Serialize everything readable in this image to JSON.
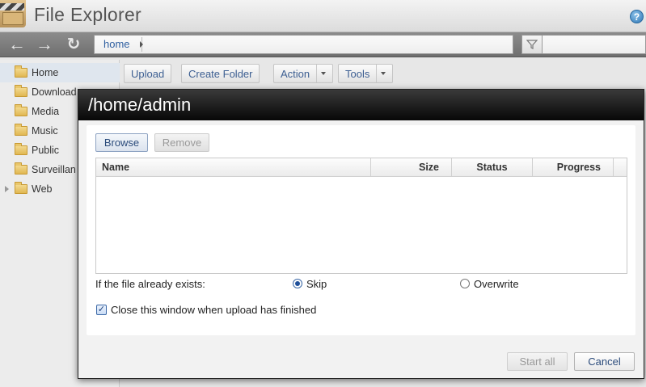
{
  "app": {
    "title": "File Explorer"
  },
  "nav": {
    "crumbs": [
      "home"
    ]
  },
  "sidebar": {
    "items": [
      {
        "label": "Home",
        "selected": true,
        "expandable": false
      },
      {
        "label": "Download",
        "selected": false,
        "expandable": false
      },
      {
        "label": "Media",
        "selected": false,
        "expandable": false
      },
      {
        "label": "Music",
        "selected": false,
        "expandable": false
      },
      {
        "label": "Public",
        "selected": false,
        "expandable": false
      },
      {
        "label": "Surveillan",
        "selected": false,
        "expandable": false
      },
      {
        "label": "Web",
        "selected": false,
        "expandable": true
      }
    ]
  },
  "toolbar": {
    "upload": "Upload",
    "create_folder": "Create Folder",
    "action": "Action",
    "tools": "Tools"
  },
  "dialog": {
    "title": "/home/admin",
    "browse": "Browse",
    "remove": "Remove",
    "columns": {
      "name": "Name",
      "size": "Size",
      "status": "Status",
      "progress": "Progress"
    },
    "exists_label": "If the file already exists:",
    "option_skip": "Skip",
    "option_overwrite": "Overwrite",
    "selected_option": "Skip",
    "close_when_done": "Close this window when upload has finished",
    "close_when_done_checked": true,
    "start_all": "Start all",
    "cancel": "Cancel"
  },
  "icons": {
    "back": "arrow-left-icon",
    "forward": "arrow-right-icon",
    "refresh": "refresh-icon",
    "filter": "funnel-icon",
    "help": "question-icon",
    "folder": "folder-icon"
  },
  "colors": {
    "accent": "#2f5fa0",
    "dialog_header": "#0a0a0a",
    "folder": "#e0b752"
  }
}
